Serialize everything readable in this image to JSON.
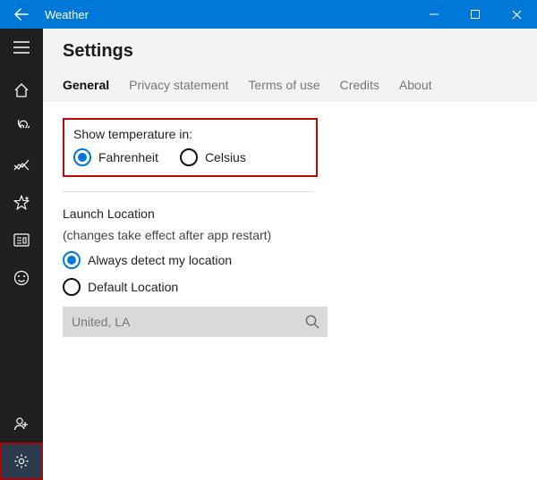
{
  "titlebar": {
    "app_name": "Weather"
  },
  "sidebar": {
    "items": [
      "menu-icon",
      "home-icon",
      "radar-icon",
      "trend-icon",
      "favorites-icon",
      "news-icon",
      "feedback-icon"
    ],
    "bottom": [
      "contact-icon",
      "settings-icon"
    ]
  },
  "settings": {
    "title": "Settings",
    "tabs": {
      "general": "General",
      "privacy": "Privacy statement",
      "terms": "Terms of use",
      "credits": "Credits",
      "about": "About"
    },
    "temperature": {
      "label": "Show temperature in:",
      "fahrenheit": "Fahrenheit",
      "celsius": "Celsius",
      "selected": "fahrenheit"
    },
    "launch": {
      "label": "Launch Location",
      "note": "(changes take effect after app restart)",
      "always": "Always detect my location",
      "default": "Default Location",
      "selected": "always"
    },
    "search": {
      "value": "United, LA"
    }
  }
}
